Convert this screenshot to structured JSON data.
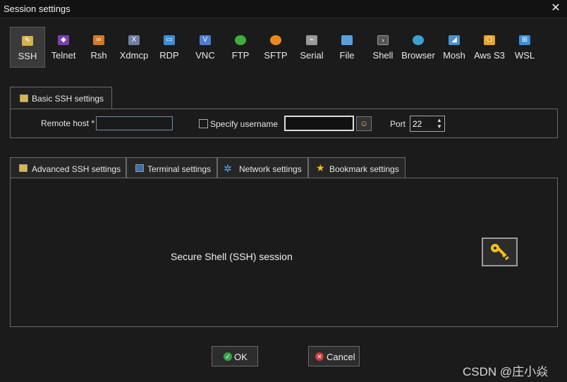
{
  "window": {
    "title": "Session settings",
    "close_glyph": "✕"
  },
  "protocols": [
    {
      "label": "SSH",
      "icon": "ssh-key-icon",
      "color": "#d6b24a",
      "selected": true
    },
    {
      "label": "Telnet",
      "icon": "telnet-icon",
      "color": "#7d3fb0"
    },
    {
      "label": "Rsh",
      "icon": "rsh-icon",
      "color": "#d07a2a"
    },
    {
      "label": "Xdmcp",
      "icon": "xdmcp-icon",
      "color": "#6e7fa0"
    },
    {
      "label": "RDP",
      "icon": "rdp-icon",
      "color": "#3a8fd8"
    },
    {
      "label": "VNC",
      "icon": "vnc-icon",
      "color": "#4a7fd0"
    },
    {
      "label": "FTP",
      "icon": "ftp-globe-icon",
      "color": "#3fae3f"
    },
    {
      "label": "SFTP",
      "icon": "sftp-icon",
      "color": "#e88a1a"
    },
    {
      "label": "Serial",
      "icon": "serial-satellite-icon",
      "color": "#9a9a9a"
    },
    {
      "label": "File",
      "icon": "file-icon",
      "color": "#5aa0d8"
    },
    {
      "label": "Shell",
      "icon": "shell-terminal-icon",
      "color": "#555555"
    },
    {
      "label": "Browser",
      "icon": "browser-globe-icon",
      "color": "#3f9fd0"
    },
    {
      "label": "Mosh",
      "icon": "mosh-antenna-icon",
      "color": "#4a90d0"
    },
    {
      "label": "Aws S3",
      "icon": "aws-s3-icon",
      "color": "#e8a52a"
    },
    {
      "label": "WSL",
      "icon": "wsl-windows-icon",
      "color": "#3a8fd8"
    }
  ],
  "basic_tab": {
    "label": "Basic SSH settings"
  },
  "basic": {
    "remote_host_label": "Remote host *",
    "remote_host_value": "",
    "specify_username_label": "Specify username",
    "username_value": "",
    "port_label": "Port",
    "port_value": "22"
  },
  "tabs": [
    {
      "label": "Advanced SSH settings",
      "icon": "wrench-key-icon"
    },
    {
      "label": "Terminal settings",
      "icon": "terminal-icon"
    },
    {
      "label": "Network settings",
      "icon": "network-icon"
    },
    {
      "label": "Bookmark settings",
      "icon": "star-icon"
    }
  ],
  "main": {
    "description": "Secure Shell (SSH) session"
  },
  "buttons": {
    "ok": {
      "label": "OK",
      "color": "#2fa84a"
    },
    "cancel": {
      "label": "Cancel",
      "color": "#d03a3a"
    }
  },
  "watermark": "CSDN @庄小焱"
}
